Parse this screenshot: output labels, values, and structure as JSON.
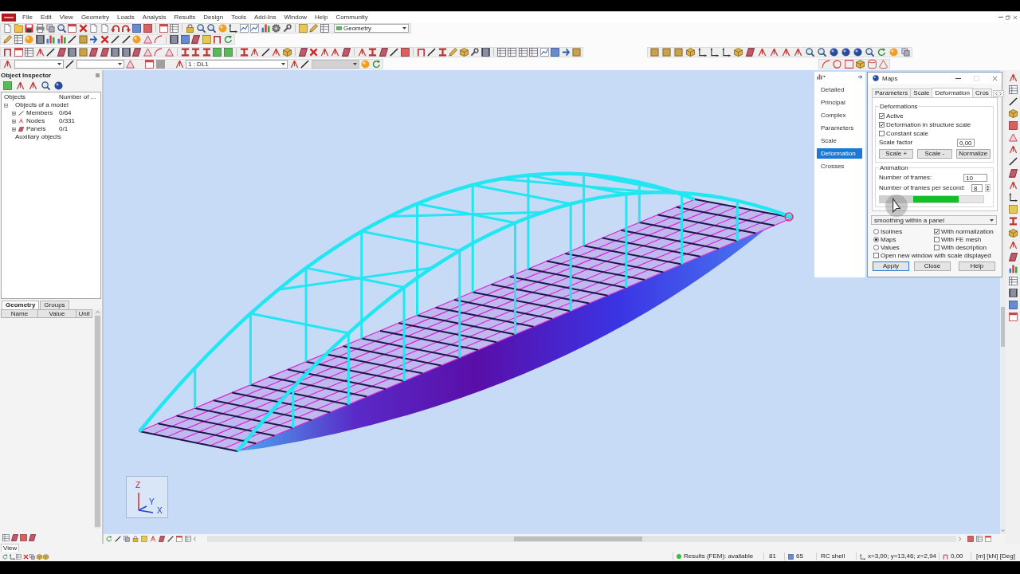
{
  "window": {
    "menu": [
      "File",
      "Edit",
      "View",
      "Geometry",
      "Loads",
      "Analysis",
      "Results",
      "Design",
      "Tools",
      "Add-Ins",
      "Window",
      "Help",
      "Community"
    ]
  },
  "toolbars": {
    "view_selector": {
      "value": "Geometry"
    },
    "load_case": {
      "value": "1 : DL1"
    }
  },
  "object_inspector": {
    "title": "Object Inspector",
    "columns": [
      "Objects",
      "Number of ..."
    ],
    "tree": [
      {
        "label": "Objects of a model",
        "expanded": true,
        "children": [
          {
            "label": "Members",
            "count": "0/64",
            "expanded": false
          },
          {
            "label": "Nodes",
            "count": "0/331",
            "expanded": false
          },
          {
            "label": "Panels",
            "count": "0/1",
            "expanded": false
          }
        ]
      },
      {
        "label": "Auxiliary objects"
      }
    ],
    "tabs": [
      {
        "label": "Geometry",
        "selected": true
      },
      {
        "label": "Groups",
        "selected": false
      }
    ],
    "property_columns": [
      "Name",
      "Value",
      "Unit"
    ]
  },
  "viewport": {
    "view_list": [
      {
        "label": "Detailed",
        "selected": false
      },
      {
        "label": "Principal",
        "selected": false
      },
      {
        "label": "Complex",
        "selected": false
      },
      {
        "label": "Parameters",
        "selected": false
      },
      {
        "label": "Scale",
        "selected": false
      },
      {
        "label": "Deformation",
        "selected": true
      },
      {
        "label": "Crosses",
        "selected": false
      }
    ],
    "axes": [
      "Z",
      "Y",
      "X"
    ]
  },
  "maps_dialog": {
    "title": "Maps",
    "tabs": [
      {
        "label": "Parameters",
        "selected": false
      },
      {
        "label": "Scale",
        "selected": false
      },
      {
        "label": "Deformation",
        "selected": true
      },
      {
        "label": "Cros",
        "selected": false
      }
    ],
    "deformations": {
      "title": "Deformations",
      "options": [
        {
          "label": "Active",
          "checked": true
        },
        {
          "label": "Deformation in structure scale",
          "checked": true
        },
        {
          "label": "Constant scale",
          "checked": false
        }
      ],
      "scale_factor": {
        "label": "Scale factor",
        "value": "0,00"
      },
      "buttons": [
        "Scale +",
        "Scale -",
        "Normalize"
      ]
    },
    "animation": {
      "title": "Animation",
      "frames": {
        "label": "Number of frames:",
        "value": "10"
      },
      "frames_per_second": {
        "label": "Number of frames per second:",
        "value": "8"
      },
      "progress": {
        "level": 0.65
      }
    },
    "smoothing": {
      "value": "smoothing within a panel"
    },
    "display_mode": [
      {
        "label": "Isolines",
        "selected": false
      },
      {
        "label": "Maps",
        "selected": true
      },
      {
        "label": "Values",
        "selected": false
      }
    ],
    "display_options": [
      {
        "label": "With normalization",
        "checked": true
      },
      {
        "label": "With FE mesh",
        "checked": false
      },
      {
        "label": "With description",
        "checked": false
      }
    ],
    "open_new_window": {
      "label": "Open new window with scale displayed",
      "checked": false
    },
    "buttons": [
      {
        "label": "Apply",
        "default": true
      },
      {
        "label": "Close",
        "default": false
      },
      {
        "label": "Help",
        "default": false
      }
    ]
  },
  "bottom_tab": {
    "label": "View"
  },
  "status_bar": {
    "results": "Results (FEM): available",
    "fields": [
      {
        "kind": "text",
        "text": "81"
      },
      {
        "kind": "structure",
        "text": "65"
      },
      {
        "kind": "text",
        "text": "RC shell"
      },
      {
        "kind": "axes",
        "text": "x=3,00; y=13,46; z=2,94"
      },
      {
        "kind": "angle",
        "text": "0,00"
      },
      {
        "kind": "text",
        "text": "[m] [kN] [Deg]"
      }
    ]
  }
}
